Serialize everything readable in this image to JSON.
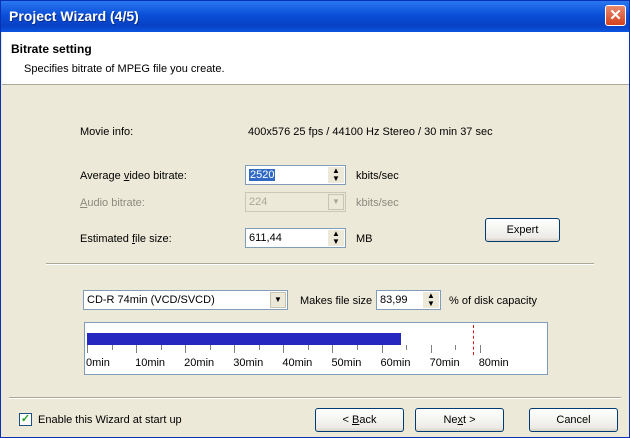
{
  "window": {
    "title": "Project Wizard (4/5)"
  },
  "header": {
    "title": "Bitrate setting",
    "subtitle": "Specifies bitrate of MPEG file you create."
  },
  "movie_info": {
    "label": "Movie info:",
    "value": "400x576 25 fps / 44100 Hz Stereo / 30 min 37 sec"
  },
  "video_bitrate": {
    "label_pre": "Average ",
    "label_key": "v",
    "label_post": "ideo bitrate:",
    "value": "2520",
    "unit": "kbits/sec"
  },
  "audio_bitrate": {
    "label_key": "A",
    "label_post": "udio bitrate:",
    "value": "224",
    "unit": "kbits/sec"
  },
  "file_size": {
    "label_pre": "Estimated ",
    "label_key": "f",
    "label_post": "ile size:",
    "value": "611,44",
    "unit": "MB"
  },
  "buttons": {
    "expert": "Expert",
    "back_pre": "< ",
    "back_key": "B",
    "back_post": "ack",
    "next_pre": "Ne",
    "next_key": "x",
    "next_post": "t >",
    "cancel": "Cancel"
  },
  "disk": {
    "selected": "CD-R 74min (VCD/SVCD)",
    "makes_label": "Makes file size",
    "percent_value": "83,99",
    "percent_label": "% of disk capacity"
  },
  "gauge": {
    "fill_fraction": 0.8399,
    "labels": [
      "0min",
      "10min",
      "20min",
      "30min",
      "40min",
      "50min",
      "60min",
      "70min",
      "80min"
    ]
  },
  "startup": {
    "label": "Enable this Wizard at start up",
    "checked": true
  }
}
